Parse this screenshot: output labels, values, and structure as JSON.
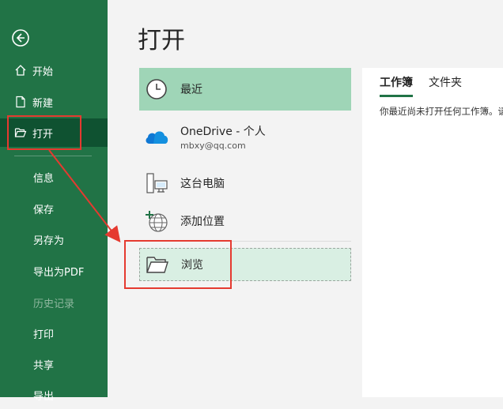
{
  "sidebar": {
    "items": [
      {
        "label": "开始"
      },
      {
        "label": "新建"
      },
      {
        "label": "打开"
      },
      {
        "label": "信息"
      },
      {
        "label": "保存"
      },
      {
        "label": "另存为"
      },
      {
        "label": "导出为PDF"
      },
      {
        "label": "历史记录"
      },
      {
        "label": "打印"
      },
      {
        "label": "共享"
      },
      {
        "label": "导出"
      }
    ]
  },
  "main": {
    "title": "打开",
    "locations": [
      {
        "label": "最近",
        "icon": "clock-icon"
      },
      {
        "label": "OneDrive - 个人",
        "sublabel": "mbxy@qq.com",
        "icon": "onedrive-cloud-icon"
      },
      {
        "label": "这台电脑",
        "icon": "computer-icon"
      },
      {
        "label": "添加位置",
        "icon": "add-globe-icon"
      },
      {
        "label": "浏览",
        "icon": "folder-icon"
      }
    ],
    "tabs": [
      {
        "label": "工作簿"
      },
      {
        "label": "文件夹"
      }
    ],
    "empty_message": "你最近尚未打开任何工作簿。请"
  },
  "colors": {
    "sidebar": "#217346",
    "sidebar_selected": "#0f5231",
    "recent_highlight": "#9fd5b7",
    "browse_highlight": "#d9efe3",
    "annotation": "#e53a30"
  }
}
